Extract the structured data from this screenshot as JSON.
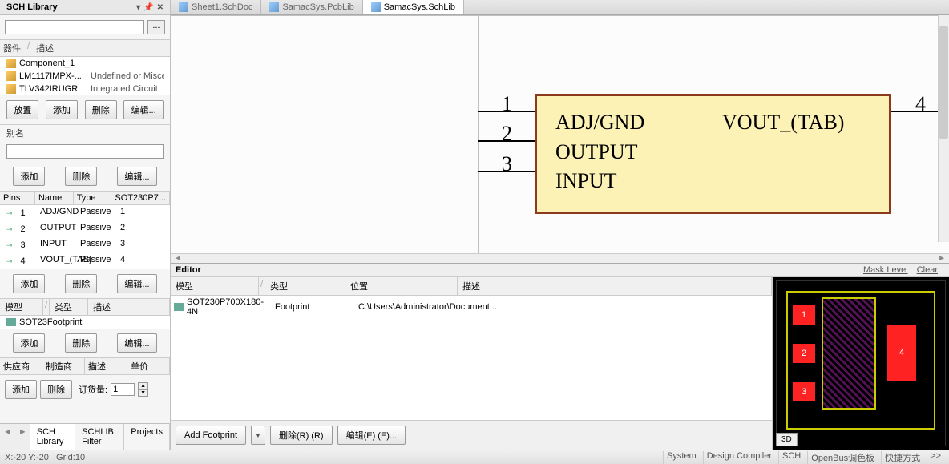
{
  "sidebar": {
    "title": "SCH Library",
    "col_component": "器件",
    "col_desc": "描述",
    "components": [
      {
        "name": "Component_1",
        "desc": ""
      },
      {
        "name": "LM1117IMPX-...",
        "desc": "Undefined or Miscellaneous"
      },
      {
        "name": "TLV342IRUGR",
        "desc": "Integrated Circuit"
      }
    ],
    "btn_place": "放置",
    "btn_add": "添加",
    "btn_delete": "删除",
    "btn_edit": "编辑...",
    "alias_label": "别名",
    "pins_hdr": {
      "pins": "Pins",
      "name": "Name",
      "type": "Type",
      "pkg": "SOT230P7..."
    },
    "pins": [
      {
        "num": "1",
        "name": "ADJ/GND",
        "type": "Passive",
        "des": "1"
      },
      {
        "num": "2",
        "name": "OUTPUT",
        "type": "Passive",
        "des": "2"
      },
      {
        "num": "3",
        "name": "INPUT",
        "type": "Passive",
        "des": "3"
      },
      {
        "num": "4",
        "name": "VOUT_(TAB)",
        "type": "Passive",
        "des": "4"
      }
    ],
    "model_hdr": {
      "model": "模型",
      "type": "类型",
      "desc": "描述"
    },
    "model_name": "SOT23Footprint",
    "supplier_hdr": {
      "supplier": "供应商",
      "mfr": "制造商",
      "desc": "描述",
      "price": "单价"
    },
    "order_label": "订货量:",
    "order_qty": "1",
    "tabs": {
      "lib": "SCH Library",
      "filter": "SCHLIB Filter",
      "projects": "Projects"
    }
  },
  "doc_tabs": [
    {
      "label": "Sheet1.SchDoc",
      "active": false
    },
    {
      "label": "SamacSys.PcbLib",
      "active": false
    },
    {
      "label": "SamacSys.SchLib",
      "active": true
    }
  ],
  "symbol": {
    "pins_left": [
      {
        "num": "1",
        "label": "ADJ/GND"
      },
      {
        "num": "2",
        "label": "OUTPUT"
      },
      {
        "num": "3",
        "label": "INPUT"
      }
    ],
    "pins_right": [
      {
        "num": "4",
        "label": "VOUT_(TAB)"
      }
    ]
  },
  "editor": {
    "title": "Editor",
    "mask_level": "Mask Level",
    "clear": "Clear",
    "hdr": {
      "model": "模型",
      "type": "类型",
      "loc": "位置",
      "desc": "描述"
    },
    "row": {
      "model": "SOT230P700X180-4N",
      "type": "Footprint",
      "loc": "C:\\Users\\Administrator\\Document..."
    },
    "btn_add_fp": "Add Footprint",
    "btn_delete": "删除(R) (R)",
    "btn_edit": "编辑(E) (E)...",
    "btn_3d": "3D",
    "pads": [
      "1",
      "2",
      "3",
      "4"
    ]
  },
  "status": {
    "coords": "X:-20 Y:-20",
    "grid": "Grid:10",
    "items": [
      "System",
      "Design Compiler",
      "SCH",
      "OpenBus调色板",
      "快捷方式",
      ">>"
    ]
  }
}
